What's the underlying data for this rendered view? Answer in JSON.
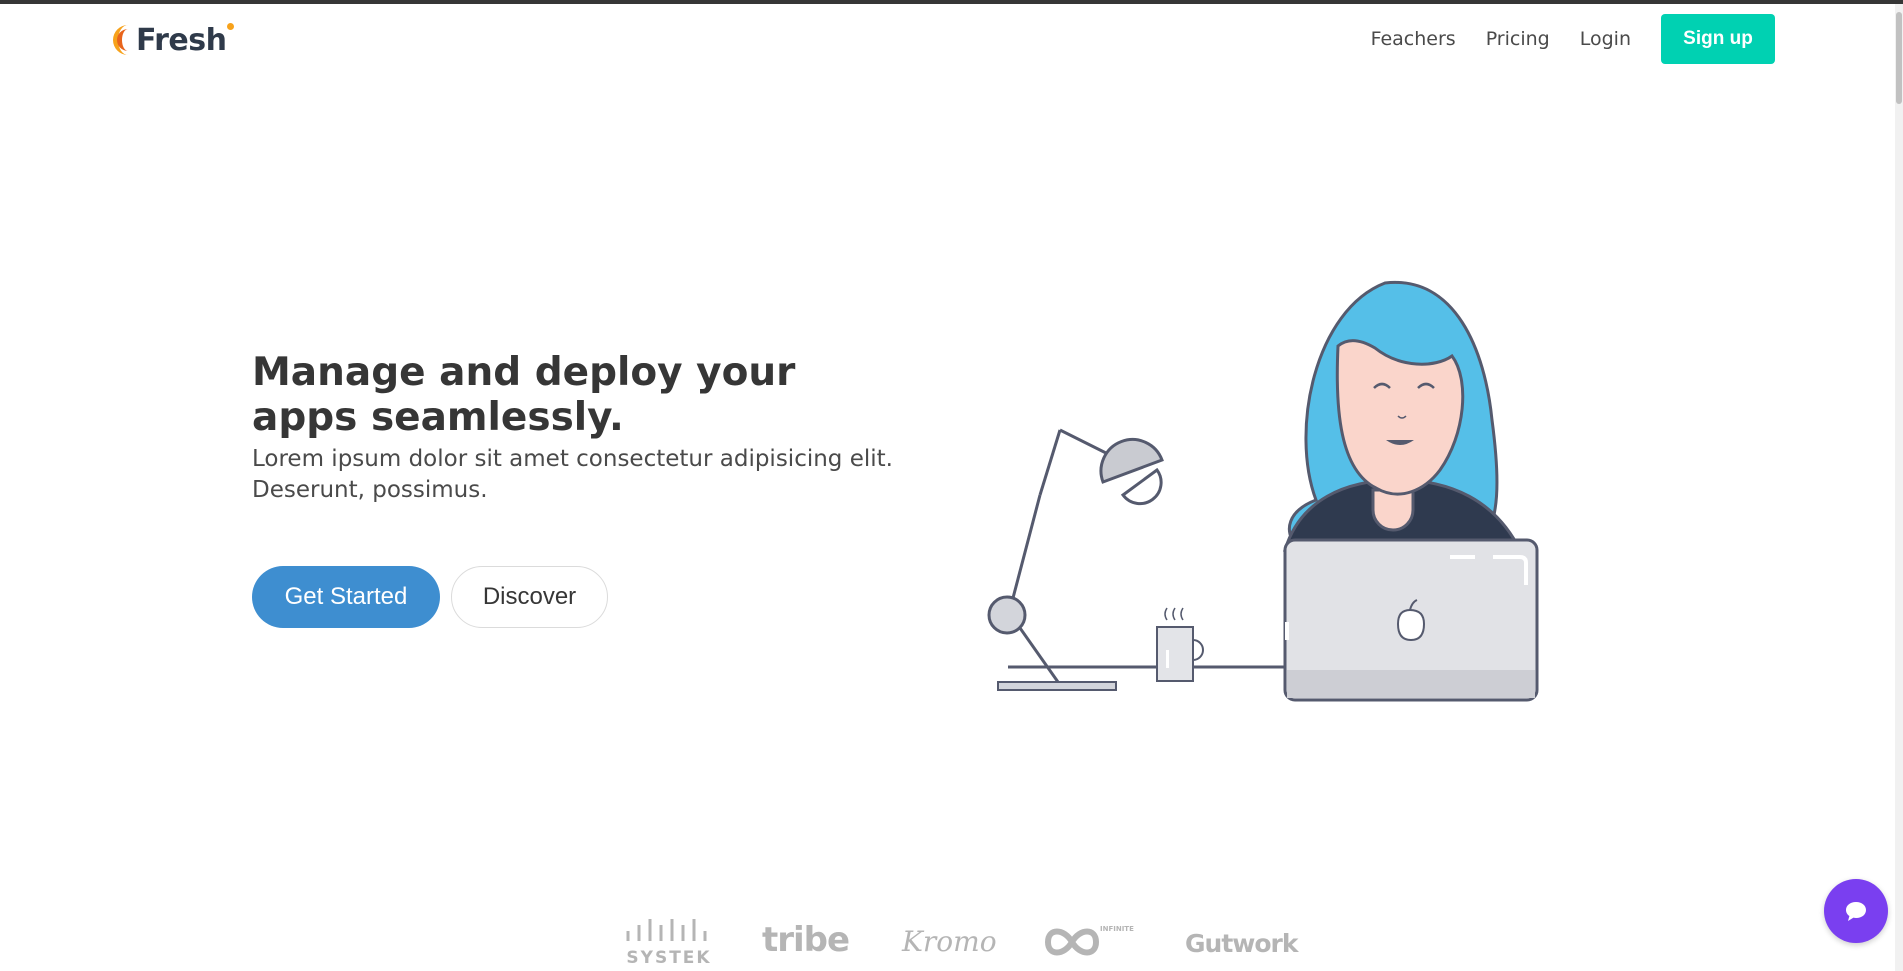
{
  "brand": {
    "name": "Fresh"
  },
  "nav": {
    "links": [
      "Feachers",
      "Pricing",
      "Login"
    ],
    "signup_label": "Sign up"
  },
  "hero": {
    "title": "Manage and deploy your apps seamlessly.",
    "subtitle": "Lorem ipsum dolor sit amet consectetur adipisicing elit. Deserunt, possimus.",
    "primary_cta": "Get Started",
    "secondary_cta": "Discover"
  },
  "clients": {
    "logos": [
      "SYSTEK",
      "tribe",
      "Kromo",
      "INFINITE",
      "Gutwork"
    ]
  },
  "colors": {
    "accent_teal": "#00d1b2",
    "primary_blue": "#3e8ed0",
    "chat_purple": "#7a3ff0",
    "hair_blue": "#55bfe8",
    "logo_orange": "#f7a21b"
  },
  "icons": {
    "chat": "chat-bubble-icon"
  }
}
